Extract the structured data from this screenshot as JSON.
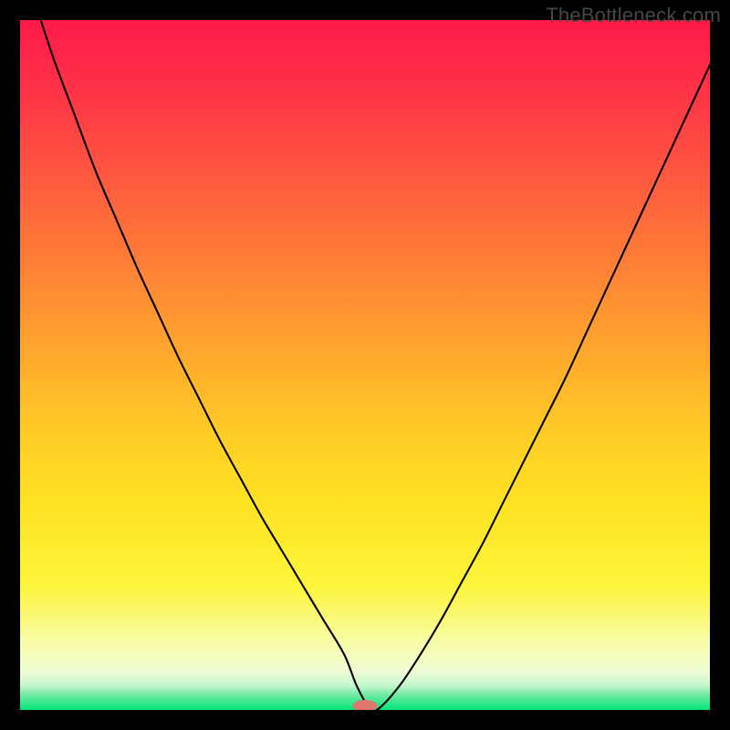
{
  "watermark": "TheBottleneck.com",
  "chart_data": {
    "type": "line",
    "title": "",
    "xlabel": "",
    "ylabel": "",
    "xlim": [
      0,
      100
    ],
    "ylim": [
      0,
      100
    ],
    "grid": false,
    "legend": false,
    "background_gradient_stops": [
      {
        "pct": 0.0,
        "color": "#ff1a4b"
      },
      {
        "pct": 0.1,
        "color": "#ff3247"
      },
      {
        "pct": 0.2,
        "color": "#ff5041"
      },
      {
        "pct": 0.3,
        "color": "#ff6f3a"
      },
      {
        "pct": 0.4,
        "color": "#ff8e33"
      },
      {
        "pct": 0.5,
        "color": "#ffad2c"
      },
      {
        "pct": 0.6,
        "color": "#ffcc25"
      },
      {
        "pct": 0.7,
        "color": "#ffe223"
      },
      {
        "pct": 0.82,
        "color": "#fdf53a"
      },
      {
        "pct": 0.9,
        "color": "#f8fca5"
      },
      {
        "pct": 0.945,
        "color": "#eefcd5"
      },
      {
        "pct": 0.965,
        "color": "#c5f6cf"
      },
      {
        "pct": 0.978,
        "color": "#71e9a3"
      },
      {
        "pct": 1.0,
        "color": "#00e67a"
      }
    ],
    "series": [
      {
        "name": "bottleneck-curve",
        "stroke": "#000000",
        "stroke_width": 2.1,
        "x": [
          3.0,
          5,
          8,
          11,
          14,
          17,
          20,
          23,
          26,
          29,
          32,
          35,
          38,
          41,
          44,
          47,
          48.8,
          50.7,
          52,
          55,
          58,
          61,
          64,
          67,
          70,
          73,
          76,
          79,
          82,
          85,
          88,
          91,
          94,
          97,
          100
        ],
        "y": [
          100,
          94,
          86,
          78,
          71,
          64,
          57.5,
          51,
          45,
          39,
          33.5,
          28,
          23,
          18,
          13,
          8,
          3.5,
          0.2,
          0.2,
          3.5,
          8,
          13,
          18.5,
          24,
          30,
          36,
          42,
          48,
          54.5,
          61,
          67.5,
          74,
          80.5,
          87,
          93.5
        ]
      }
    ],
    "marker": {
      "name": "bottleneck-marker",
      "x": 50.0,
      "y": 0.6,
      "rx": 1.8,
      "ry": 0.85,
      "fill": "#e0776d"
    }
  }
}
